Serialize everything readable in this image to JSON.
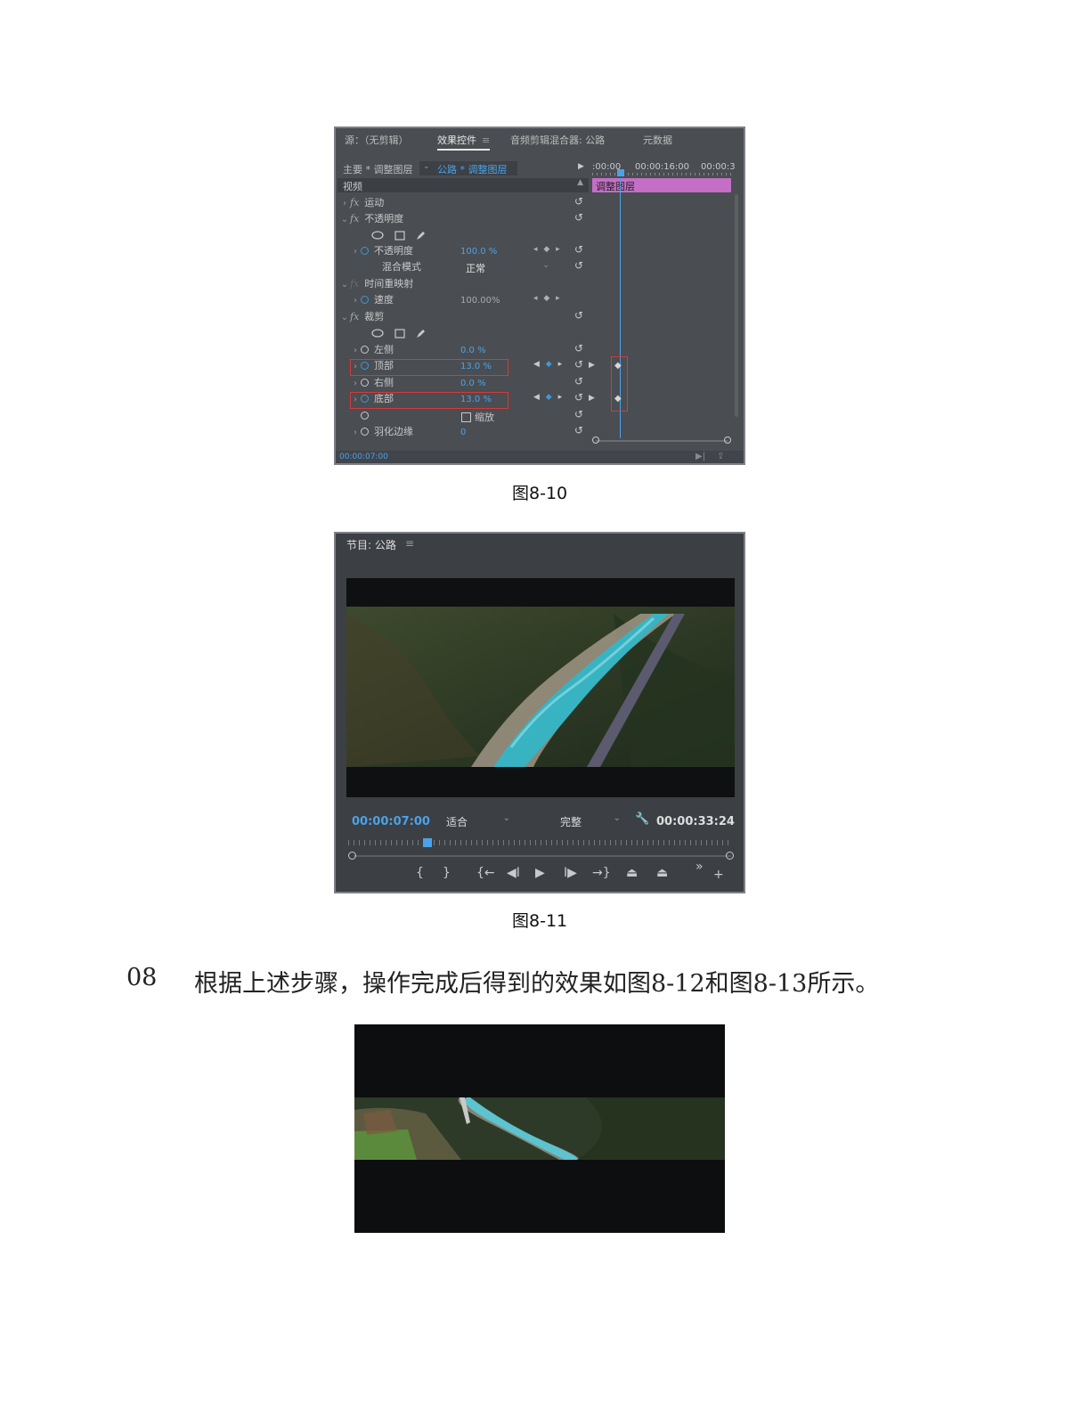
{
  "effect_controls": {
    "tabs": [
      "源：（无剪辑）",
      "效果控件",
      "音频剪辑混合器: 公路",
      "元数据"
    ],
    "menu_icon": "≡",
    "master_clip": "主要 * 调整图层",
    "sequence_clip": "公路 * 调整图层",
    "ruler": {
      "t0": ":00:00",
      "t1": "00:00:16:00",
      "t2": "00:00:3"
    },
    "clip_bar_label": "调整图层",
    "section": "视频",
    "rows": {
      "motion": "运动",
      "opacity": "不透明度",
      "opacity_param": "不透明度",
      "opacity_value": "100.0 %",
      "blend_mode": "混合模式",
      "blend_value": "正常",
      "time_remap": "时间重映射",
      "speed": "速度",
      "speed_value": "100.00%",
      "crop": "裁剪",
      "left": "左侧",
      "left_value": "0.0 %",
      "top": "顶部",
      "top_value": "13.0 %",
      "right": "右侧",
      "right_value": "0.0 %",
      "bottom": "底部",
      "bottom_value": "13.0 %",
      "zoom_label": "缩放",
      "feather": "羽化边缘",
      "feather_value": "0"
    },
    "timecode": "00:00:07:00"
  },
  "caption_1": "图8-10",
  "program_monitor": {
    "title": "节目: 公路",
    "menu_icon": "≡",
    "current_time": "00:00:07:00",
    "fit": "适合",
    "quality": "完整",
    "duration": "00:00:33:24",
    "controls": [
      "{",
      "}",
      "{←",
      "◀I",
      "▶",
      "I▶",
      "→}",
      "⏏",
      "⏏",
      "»",
      "+"
    ]
  },
  "caption_2": "图8-11",
  "step": {
    "number": "08",
    "text": "根据上述步骤，操作完成后得到的效果如图8-12和图8-13所示。"
  },
  "colors": {
    "panel_bg": "#4a4d52",
    "accent_blue": "#4aa3e8",
    "clip_bar": "#c46ec6",
    "highlight_red": "#d23b3b"
  }
}
